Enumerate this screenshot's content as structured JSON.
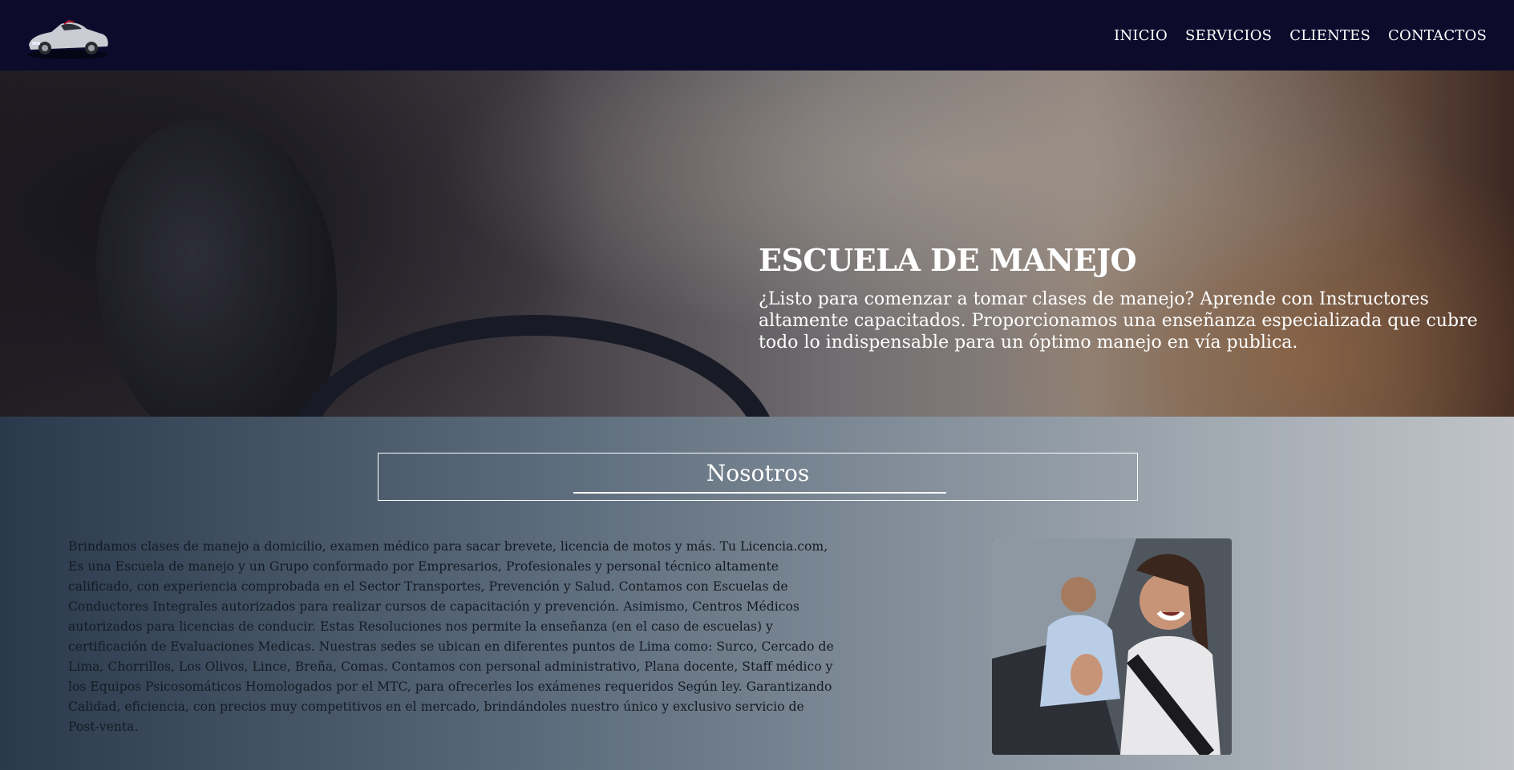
{
  "nav": {
    "logo_alt": "car-logo",
    "links": [
      "INICIO",
      "SERVICIOS",
      "CLIENTES",
      "CONTACTOS"
    ]
  },
  "hero": {
    "title": "ESCUELA DE MANEJO",
    "text": "¿Listo para comenzar a tomar clases de manejo? Aprende con Instructores altamente capacitados. Proporcionamos una enseñanza especializada que cubre todo lo indispensable para un óptimo manejo en vía publica."
  },
  "about": {
    "title": "Nosotros",
    "text": "Brindamos clases de manejo a domicilio, examen médico para sacar brevete, licencia de motos y más. Tu Licencia.com, Es una Escuela de manejo y un Grupo conformado por Empresarios, Profesionales y personal técnico altamente calificado, con experiencia comprobada en el Sector Transportes, Prevención y Salud. Contamos con Escuelas de Conductores Integrales autorizados para realizar cursos de capacitación y prevención. Asimismo, Centros Médicos autorizados para licencias de conducir. Estas Resoluciones nos permite la enseñanza (en el caso de escuelas) y certificación de Evaluaciones Medicas. Nuestras sedes se ubican en diferentes puntos de Lima como: Surco, Cercado de Lima, Chorrillos, Los Olivos, Lince, Breña, Comas. Contamos con personal administrativo, Plana docente, Staff médico y los Equipos Psicosomáticos Homologados por el MTC, para ofrecerles los exámenes requeridos Según ley. Garantizando Calidad, eficiencia, con precios muy competitivos en el mercado, brindándoles nuestro único y exclusivo servicio de Post-venta."
  },
  "colors": {
    "navbar": "#0d0b2c",
    "text_light": "#ffffff",
    "text_dark": "#141a24"
  }
}
